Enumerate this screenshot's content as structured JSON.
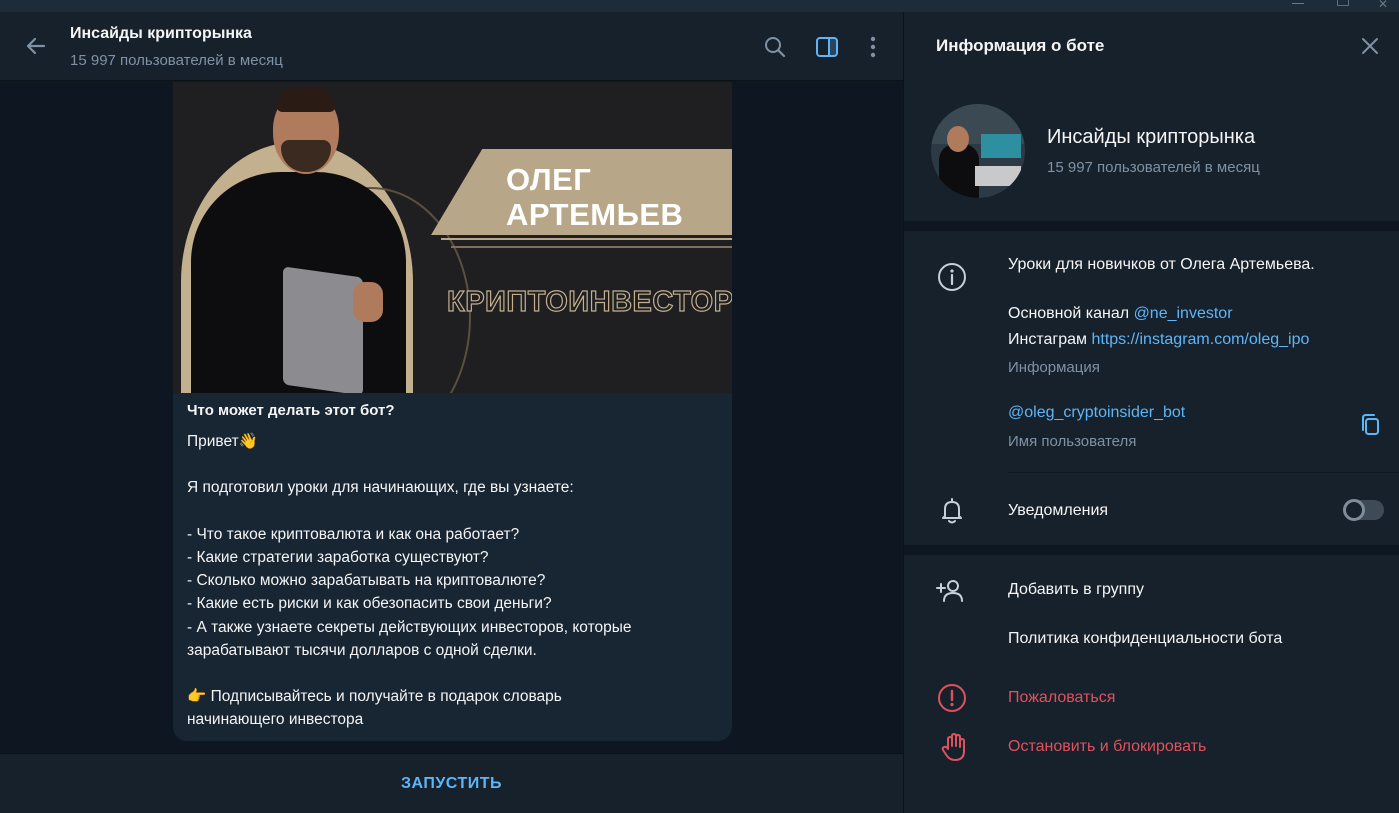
{
  "window": {
    "minimize_glyph": "",
    "close_glyph": "✕"
  },
  "chat": {
    "title": "Инсайды крипторынка",
    "subtitle": "15 997 пользователей в месяц"
  },
  "message": {
    "banner_name": "ОЛЕГ\nАРТЕМЬЕВ",
    "banner_role": "КРИПТОИНВЕСТОР",
    "question": "Что может делать этот бот?",
    "body": "Привет👋\n\nЯ подготовил уроки для начинающих, где вы узнаете:\n\n- Что такое криптовалюта и как она работает?\n- Какие стратегии заработка существуют?\n- Сколько можно зарабатывать на криптовалюте?\n- Какие есть риски и как обезопасить свои деньги?\n- А также узнаете секреты действующих инвесторов, которые\nзарабатывают тысячи долларов с одной сделки.\n\n👉 Подписывайтесь и получайте в подарок словарь\nначинающего инвестора"
  },
  "composer": {
    "start_label": "ЗАПУСТИТЬ"
  },
  "panel": {
    "title": "Информация о боте",
    "name": "Инсайды крипторынка",
    "subtitle": "15 997 пользователей в месяц",
    "about_line1": "Уроки для новичков от Олега Артемьева.",
    "channel_prefix": "Основной канал ",
    "channel_link": "@ne_investor",
    "instagram_prefix": "Инстаграм ",
    "instagram_link": "https://instagram.com/oleg_ipo",
    "info_label": "Информация",
    "username": "@oleg_cryptoinsider_bot",
    "username_label": "Имя пользователя",
    "notifications_label": "Уведомления",
    "add_to_group": "Добавить в группу",
    "privacy_policy": "Политика конфиденциальности бота",
    "report": "Пожаловаться",
    "stop_block": "Остановить и блокировать"
  },
  "colors": {
    "accent": "#5eb5f7",
    "danger": "#e0515e",
    "panel_bg": "#17212b",
    "chat_bg": "#0e1621",
    "bubble_bg": "#182533"
  },
  "icons": [
    "back-arrow-icon",
    "search-icon",
    "side-panel-icon",
    "more-vertical-icon",
    "close-icon",
    "info-icon",
    "copy-icon",
    "bell-icon",
    "add-user-icon",
    "report-icon",
    "hand-stop-icon"
  ],
  "toggle": {
    "notifications_on": false
  }
}
